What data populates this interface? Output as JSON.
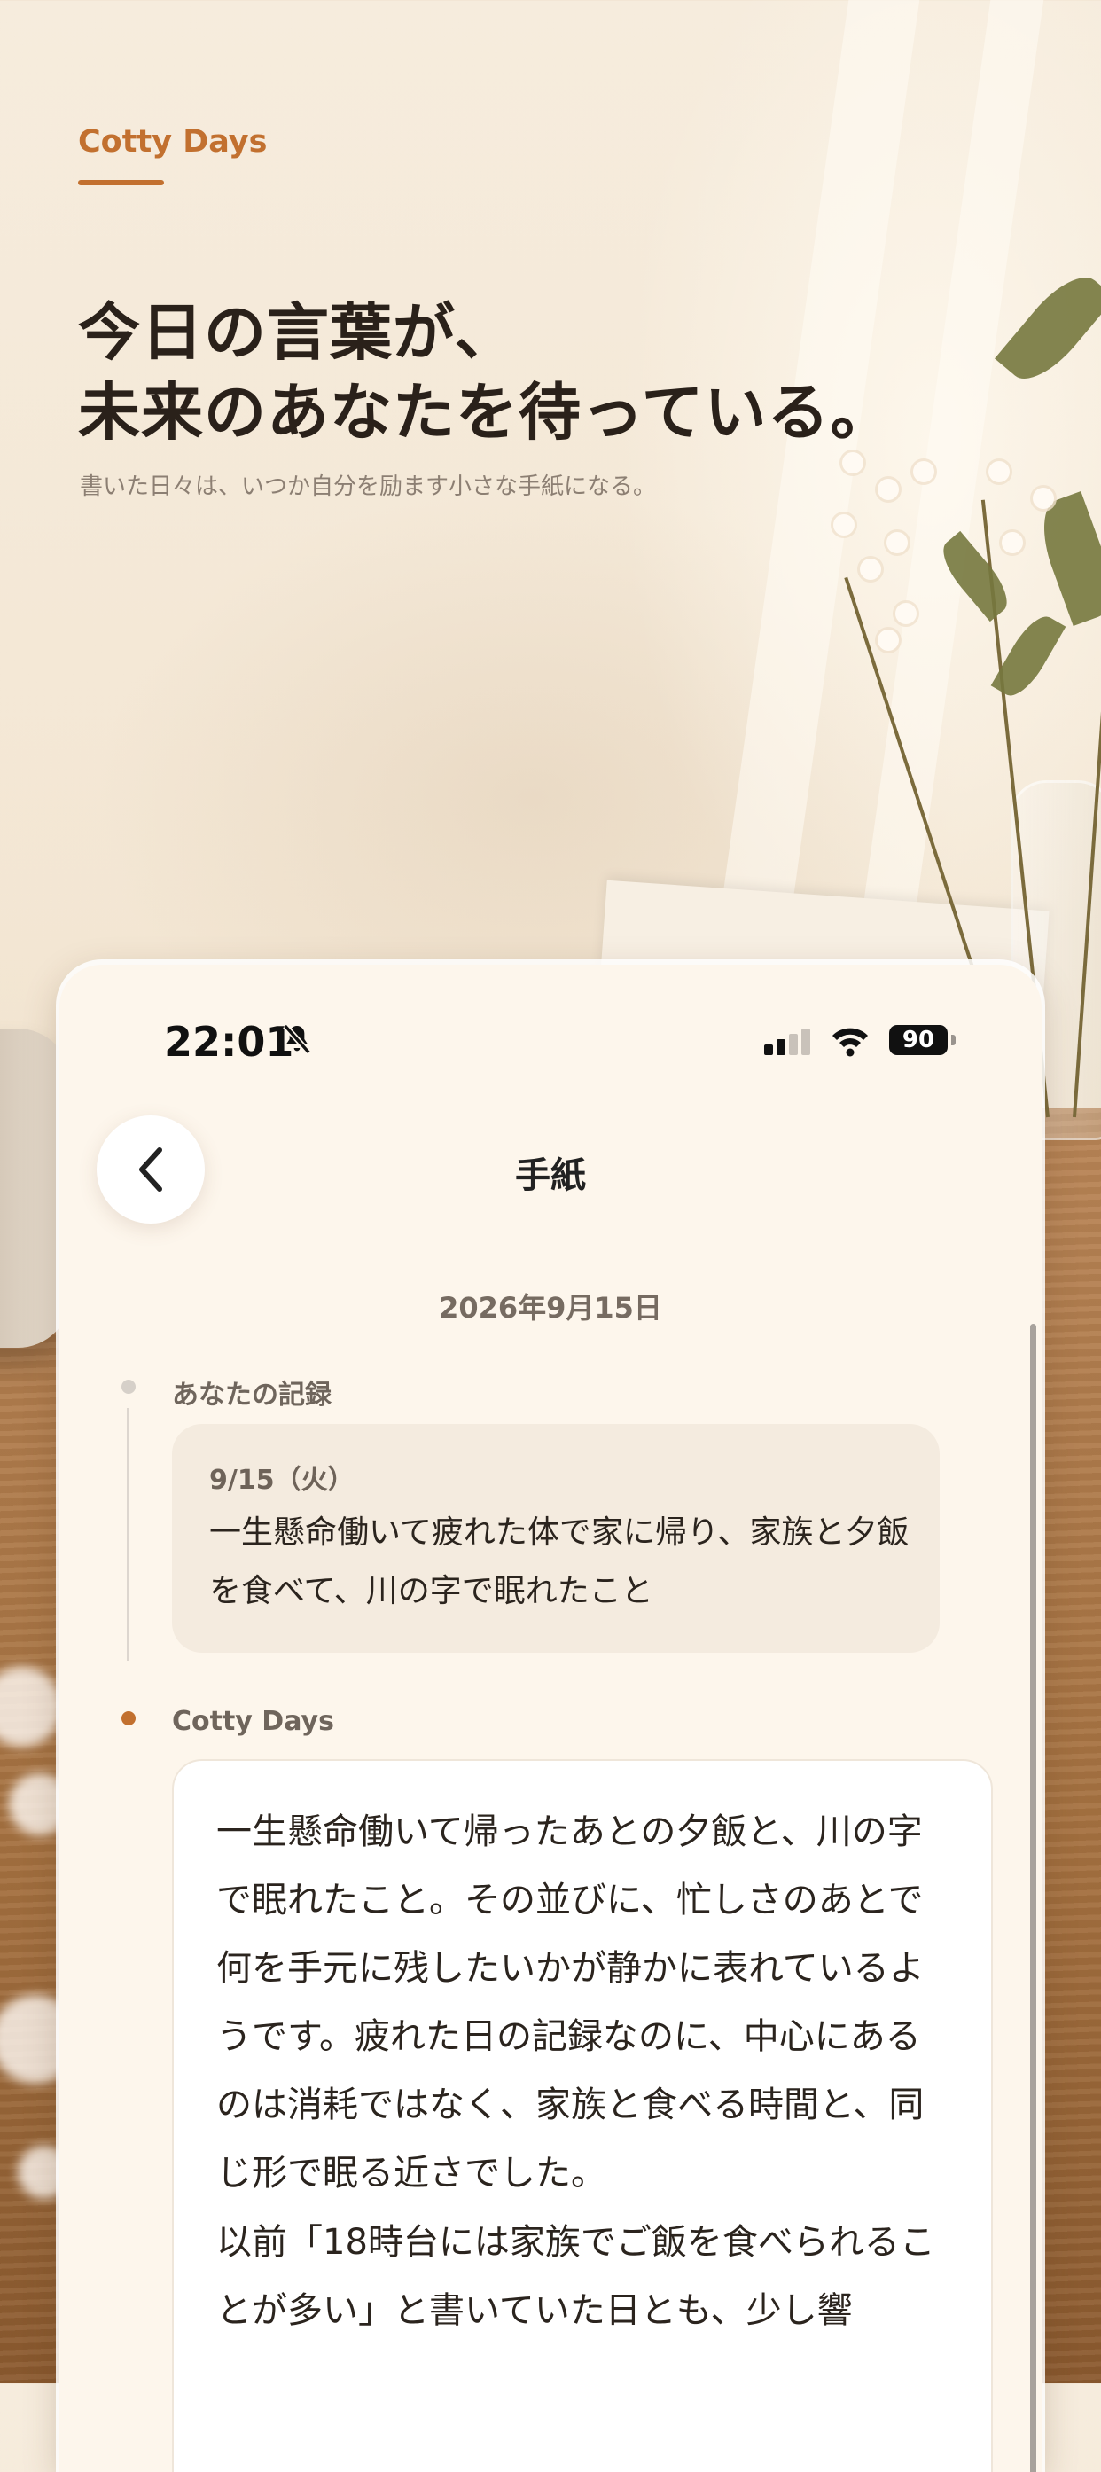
{
  "hero": {
    "brand": "Cotty Days",
    "headline_line1": "今日の言葉が、",
    "headline_line2": "未来のあなたを待っている。",
    "subcopy": "書いた日々は、いつか自分を励ます小さな手紙になる。"
  },
  "status_bar": {
    "time": "22:01",
    "battery": "90",
    "icons": [
      "bell-slash-icon",
      "signal-icon",
      "wifi-icon",
      "battery-icon"
    ]
  },
  "screen": {
    "title": "手紙",
    "back_icon": "chevron-left-icon",
    "date": "2026年9月15日",
    "user_section_label": "あなたの記録",
    "user_entry_date": "9/15（火）",
    "user_entry_text": "一生懸命働いて疲れた体で家に帰り、家族と夕飯を食べて、川の字で眠れたこと",
    "reply_section_label": "Cotty Days",
    "reply_paragraph1": "一生懸命働いて帰ったあとの夕飯と、川の字で眠れたこと。その並びに、忙しさのあとで何を手元に残したいかが静かに表れているようです。疲れた日の記録なのに、中心にあるのは消耗ではなく、家族と食べる時間と、同じ形で眠る近さでした。",
    "reply_paragraph2": "以前「18時台には家族でご飯を食べられることが多い」と書いていた日とも、少し響"
  },
  "colors": {
    "accent": "#c2702f",
    "card_background": "#fdf6ec",
    "user_card": "#f4ebdf"
  }
}
